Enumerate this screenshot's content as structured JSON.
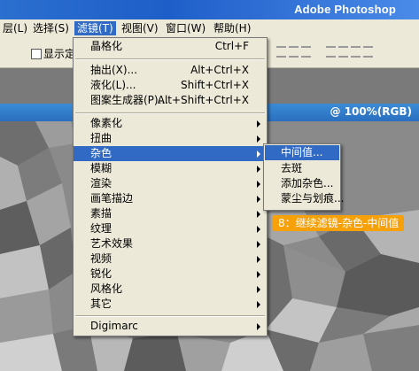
{
  "app_title": "Adobe Photoshop",
  "menubar": {
    "items": [
      {
        "label": "层(L)",
        "active": false
      },
      {
        "label": "选择(S)",
        "active": false
      },
      {
        "label": "滤镜(T)",
        "active": true
      },
      {
        "label": "视图(V)",
        "active": false
      },
      {
        "label": "窗口(W)",
        "active": false
      },
      {
        "label": "帮助(H)",
        "active": false
      }
    ]
  },
  "options": {
    "checkbox_label": "显示定"
  },
  "document": {
    "title_suffix": "@ 100%(RGB)"
  },
  "filter_menu": {
    "items": [
      {
        "label": "晶格化",
        "shortcut": "Ctrl+F"
      },
      {
        "label": "抽出(X)...",
        "shortcut": "Alt+Ctrl+X"
      },
      {
        "label": "液化(L)...",
        "shortcut": "Shift+Ctrl+X"
      },
      {
        "label": "图案生成器(P)...",
        "shortcut": "Alt+Shift+Ctrl+X"
      },
      {
        "label": "像素化"
      },
      {
        "label": "扭曲"
      },
      {
        "label": "杂色"
      },
      {
        "label": "模糊"
      },
      {
        "label": "渲染"
      },
      {
        "label": "画笔描边"
      },
      {
        "label": "素描"
      },
      {
        "label": "纹理"
      },
      {
        "label": "艺术效果"
      },
      {
        "label": "视频"
      },
      {
        "label": "锐化"
      },
      {
        "label": "风格化"
      },
      {
        "label": "其它"
      },
      {
        "label": "Digimarc"
      }
    ]
  },
  "noise_submenu": {
    "items": [
      {
        "label": "中间值..."
      },
      {
        "label": "去斑"
      },
      {
        "label": "添加杂色..."
      },
      {
        "label": "蒙尘与划痕..."
      }
    ]
  },
  "step_tag": "8：继续滤镜-杂色-中间值",
  "colors": {
    "highlight": "#316ac5",
    "menu_bg": "#ece9d8",
    "step_tag": "#f6a10a"
  }
}
